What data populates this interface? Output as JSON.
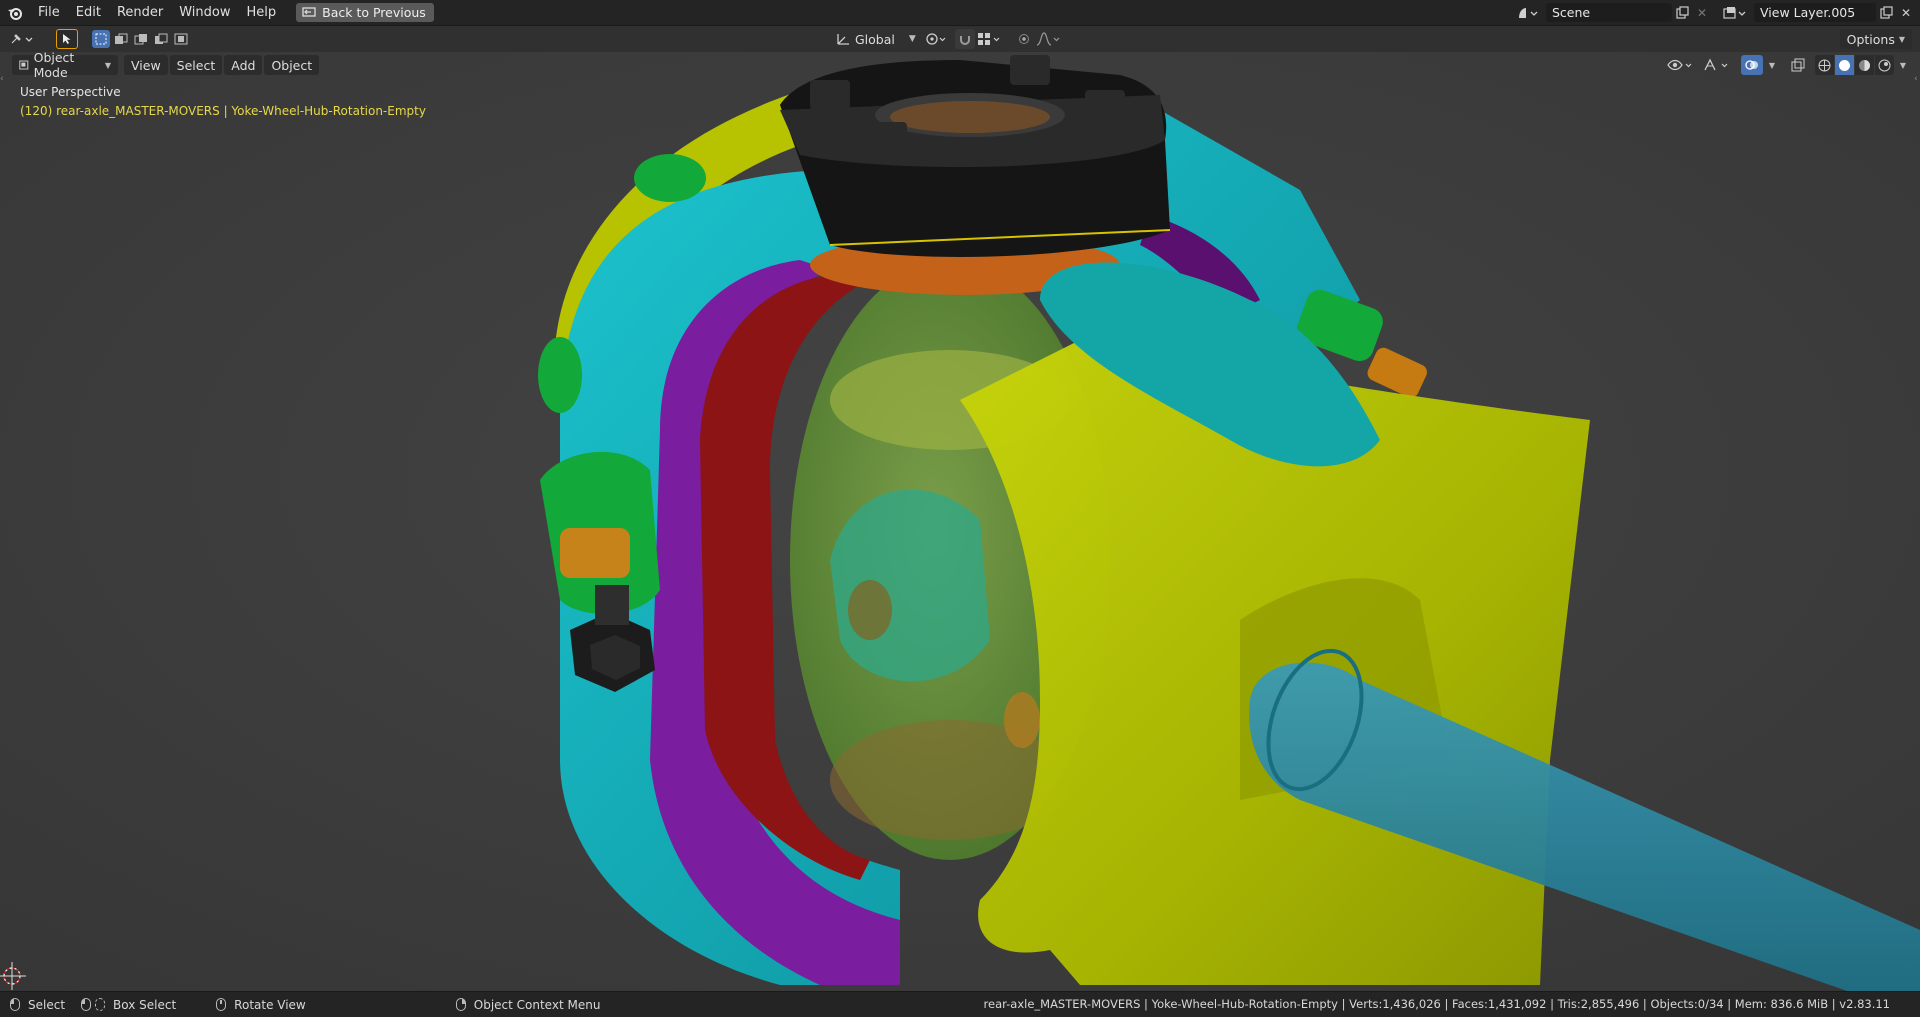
{
  "topbar": {
    "menus": [
      "File",
      "Edit",
      "Render",
      "Window",
      "Help"
    ],
    "back_label": "Back to Previous",
    "scene": "Scene",
    "view_layer": "View Layer.005"
  },
  "toolheader": {
    "orientation": "Global",
    "options_label": "Options"
  },
  "viewport": {
    "mode": "Object Mode",
    "menus": [
      "View",
      "Select",
      "Add",
      "Object"
    ],
    "perspective_label": "User Perspective",
    "active_object_label": "(120) rear-axle_MASTER-MOVERS | Yoke-Wheel-Hub-Rotation-Empty"
  },
  "statusbar": {
    "select": "Select",
    "box_select": "Box Select",
    "rotate_view": "Rotate View",
    "context_menu": "Object Context Menu",
    "info": "rear-axle_MASTER-MOVERS | Yoke-Wheel-Hub-Rotation-Empty | Verts:1,436,026 | Faces:1,431,092 | Tris:2,855,496 | Objects:0/34 | Mem: 836.6 MiB | v2.83.11"
  },
  "colors": {
    "header_bg": "#242424",
    "viewport_bg": "#3b3b3b",
    "accent_blue": "#4772b3",
    "overlay_text_yellow": "#e6d84a",
    "part_yellow": "#b9c400",
    "part_cyan": "#13a8b4",
    "part_green": "#12a83a",
    "part_purple": "#7a1d9e",
    "part_red": "#9a1010",
    "part_orange": "#c67a12",
    "part_black": "#1a1a1a",
    "part_teal_shaft": "#2b8aa0"
  }
}
